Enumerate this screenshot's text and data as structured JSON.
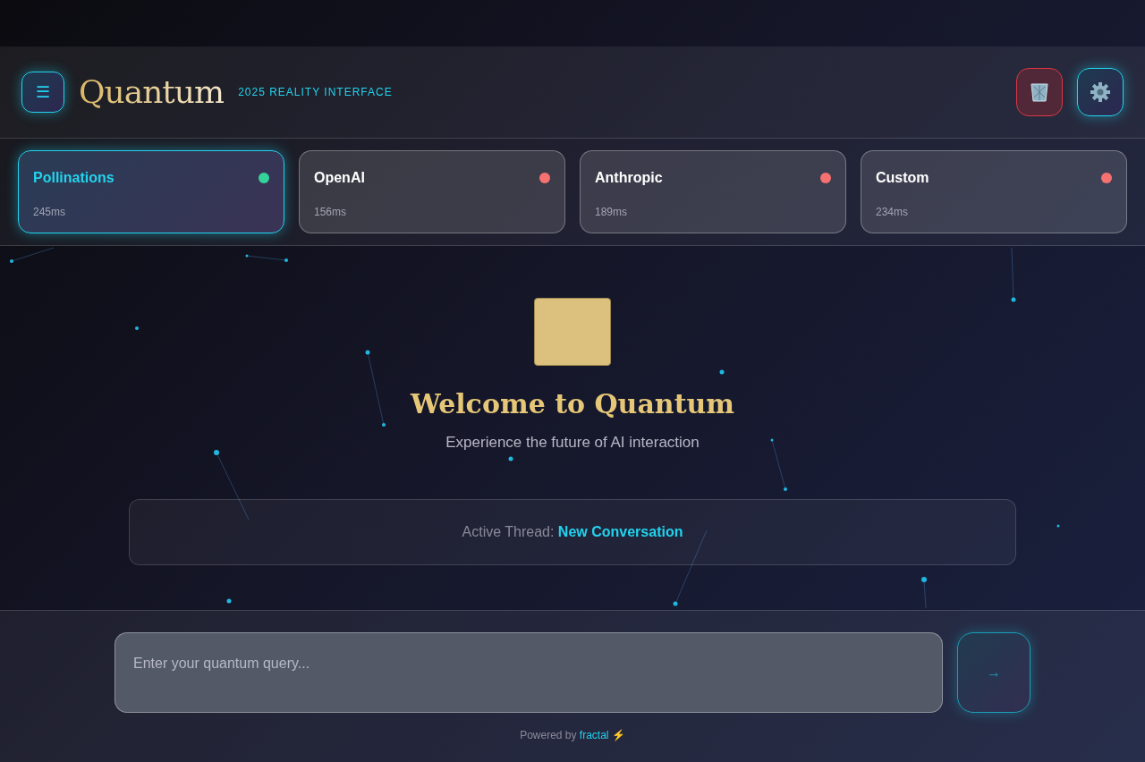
{
  "header": {
    "menu_glyph": "☰",
    "title": "Quantum",
    "tagline": "2025 REALITY INTERFACE"
  },
  "providers": [
    {
      "name": "Pollinations",
      "latency": "245ms",
      "color": "#34d399",
      "selected": true
    },
    {
      "name": "OpenAI",
      "latency": "156ms",
      "color": "#f87171",
      "selected": false
    },
    {
      "name": "Anthropic",
      "latency": "189ms",
      "color": "#f87171",
      "selected": false
    },
    {
      "name": "Custom",
      "latency": "234ms",
      "color": "#f87171",
      "selected": false
    }
  ],
  "welcome": {
    "title": "Welcome to Quantum",
    "subtitle": "Experience the future of AI interaction"
  },
  "thread": {
    "label": "Active Thread:",
    "name": "New Conversation"
  },
  "composer": {
    "placeholder": "Enter your quantum query...",
    "send_glyph": "→"
  },
  "footer": {
    "prefix": "Powered by",
    "link": "fractal",
    "suffix": "⚡"
  }
}
